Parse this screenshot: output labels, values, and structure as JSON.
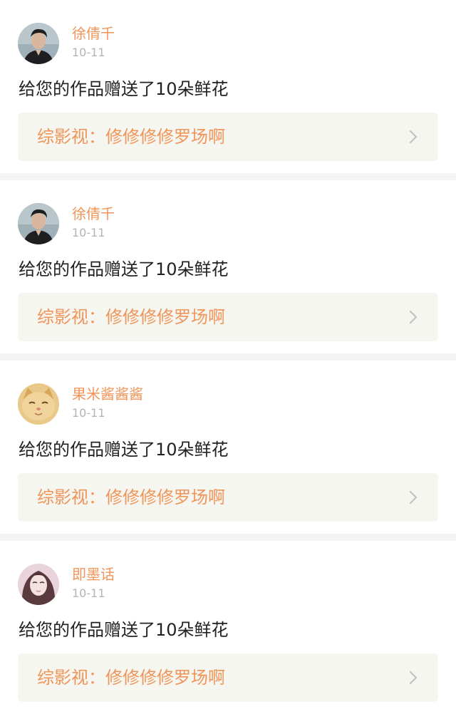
{
  "notifications": [
    {
      "avatar": "man-portrait-avatar",
      "username": "徐倩千",
      "date": "10-11",
      "message": "给您的作品赠送了10朵鲜花",
      "work_title": "综影视：修修修修罗场啊"
    },
    {
      "avatar": "man-portrait-avatar",
      "username": "徐倩千",
      "date": "10-11",
      "message": "给您的作品赠送了10朵鲜花",
      "work_title": "综影视：修修修修罗场啊"
    },
    {
      "avatar": "kitten-avatar",
      "username": "果米酱酱酱",
      "date": "10-11",
      "message": "给您的作品赠送了10朵鲜花",
      "work_title": "综影视：修修修修罗场啊"
    },
    {
      "avatar": "woman-portrait-avatar",
      "username": "即墨话",
      "date": "10-11",
      "message": "给您的作品赠送了10朵鲜花",
      "work_title": "综影视：修修修修罗场啊"
    }
  ],
  "colors": {
    "accent": "#f0955a",
    "tab_indicator": "#f07fb0",
    "card_link_bg": "#f6f6f1"
  },
  "icons": {
    "chevron": "chevron-right-icon"
  }
}
